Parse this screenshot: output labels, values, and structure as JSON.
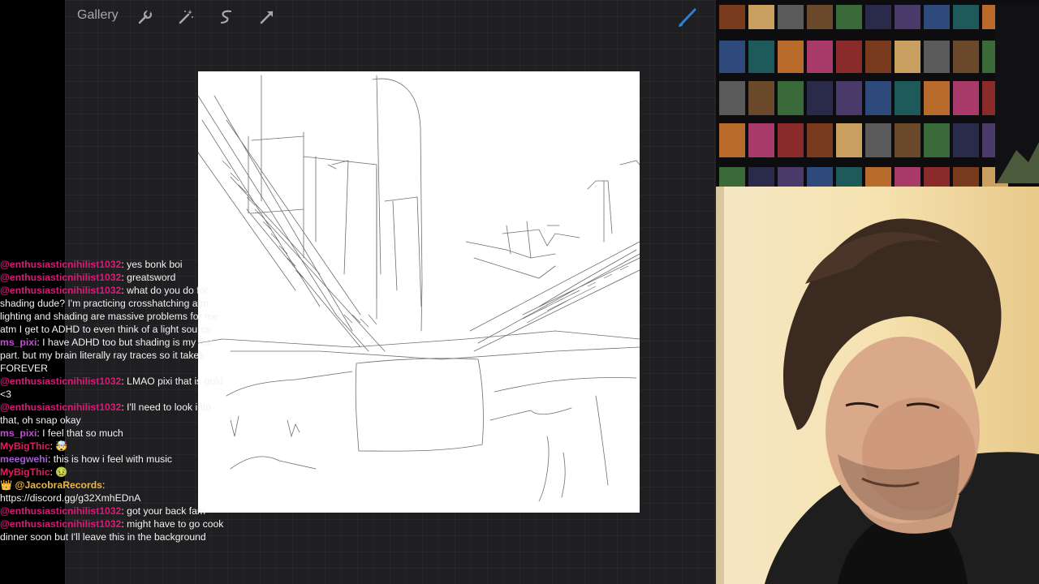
{
  "toolbar": {
    "gallery_label": "Gallery",
    "tools": [
      {
        "name": "wrench-icon"
      },
      {
        "name": "magic-wand-icon"
      },
      {
        "name": "selection-icon"
      },
      {
        "name": "transform-arrow-icon"
      }
    ],
    "brush_icon": "brush-icon",
    "brush_color": "#2f7fd6"
  },
  "colors": {
    "app_bg": "#1f1f22",
    "username_pink": "#d81b7a",
    "username_purple": "#a45bd6",
    "username_gold": "#e8b84a"
  },
  "chat": {
    "messages": [
      {
        "user": "@enthusiasticnihilist1032",
        "text": ": yes bonk boi",
        "color": "#d81b7a"
      },
      {
        "user": "@enthusiasticnihilist1032",
        "text": ": greatsword",
        "color": "#d81b7a"
      },
      {
        "user": "@enthusiasticnihilist1032",
        "text": ": what do you do for shading dude? I'm practicing crosshatching atm lighting and shading are massive problems for me atm I get to ADHD to even think of a light source",
        "color": "#d81b7a"
      },
      {
        "user": "ms_pixi",
        "text": ": I have ADHD too but shading is my fav part. but my brain literally ray traces so it takes FOREVER",
        "color": "#c74bd6"
      },
      {
        "user": "@enthusiasticnihilist1032",
        "text": ": LMAO pixi that is gold <3",
        "color": "#d81b7a"
      },
      {
        "user": "@enthusiasticnihilist1032",
        "text": ": I'll need to look into that, oh snap okay",
        "color": "#d81b7a"
      },
      {
        "user": "ms_pixi",
        "text": ": I feel that so much",
        "color": "#c74bd6"
      },
      {
        "user": "MyBigThic",
        "text": ": 🤯",
        "color": "#e01f5a"
      },
      {
        "user": "meegwehi",
        "text": ": this is how i feel with music",
        "color": "#a45bd6"
      },
      {
        "user": "MyBigThic",
        "text": ": 🤢",
        "color": "#e01f5a"
      },
      {
        "user": "👑 @JacobraRecords",
        "text": ": https://discord.gg/g32XmhEDnA",
        "color": "#e8b84a"
      },
      {
        "user": "@enthusiasticnihilist1032",
        "text": ": got your back fam",
        "color": "#d81b7a"
      },
      {
        "user": "@enthusiasticnihilist1032",
        "text": ": might have to go cook dinner soon but I'll leave this in the background",
        "color": "#d81b7a"
      }
    ]
  }
}
